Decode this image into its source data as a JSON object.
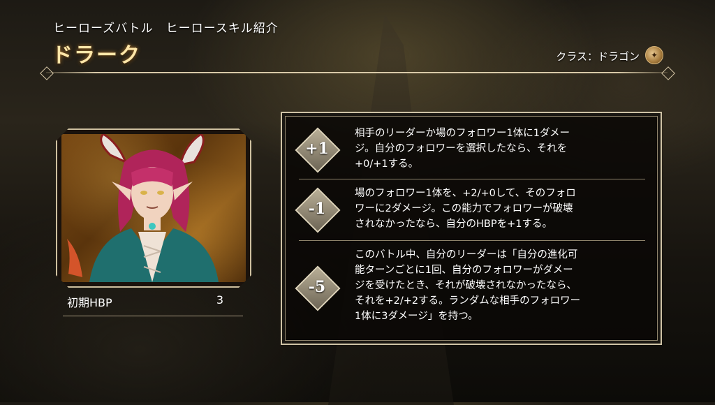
{
  "header": {
    "subtitle": "ヒーローズバトル　ヒーロースキル紹介",
    "title": "ドラーク",
    "class_label": "クラス：ドラゴン",
    "class_icon": "dragon-class-icon"
  },
  "portrait": {
    "hp_label": "初期HBP",
    "hp_value": "3"
  },
  "skills": [
    {
      "cost": "+1",
      "text": "相手のリーダーか場のフォロワー1体に1ダメー\nジ。自分のフォロワーを選択したなら、それを\n+0/+1する。"
    },
    {
      "cost": "-1",
      "text": "場のフォロワー1体を、+2/+0して、そのフォロ\nワーに2ダメージ。この能力でフォロワーが破壊\nされなかったなら、自分のHBPを+1する。"
    },
    {
      "cost": "-5",
      "text": "このバトル中、自分のリーダーは「自分の進化可\n能ターンごとに1回、自分のフォロワーがダメー\nジを受けたとき、それが破壊されなかったなら、\nそれを+2/+2する。ランダムな相手のフォロワー\n1体に3ダメージ」を持つ。"
    }
  ]
}
